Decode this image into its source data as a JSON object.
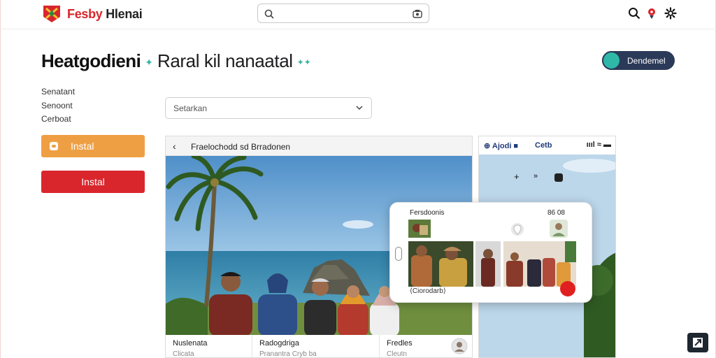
{
  "brand": {
    "name_part1": "Fesby",
    "name_part2": " Hlenai"
  },
  "search": {
    "value": "",
    "placeholder": ""
  },
  "page": {
    "title_bold": "Heatgodieni",
    "title_rest": "Raral kil nanaatal",
    "toggle_label": "Dendemel"
  },
  "sidebar": {
    "links": [
      "Senatant",
      "Senoont",
      "Cerboat"
    ],
    "install_primary": "Instal",
    "install_secondary": "Instal"
  },
  "select": {
    "value": "Setarkan"
  },
  "card": {
    "header_title": "Fraelochodd sd Brradonen",
    "footer": [
      {
        "title": "Nuslenata",
        "sub": "Clicata"
      },
      {
        "title": "Radogdriga",
        "sub": "Pranantra  Cryb ba"
      },
      {
        "title": "Fredles",
        "sub": "Cleutn"
      }
    ]
  },
  "phone": {
    "status_left": "Ajodi",
    "status_mid": "Cetb",
    "status_right": "ıııl ≈ ▬",
    "dialog_title": "Fersdoonis",
    "dialog_right": "86 08",
    "dialog_caption": "Ciorodarb"
  },
  "colors": {
    "accent_red": "#d9262c",
    "accent_orange": "#ef9f43",
    "accent_teal": "#2fb8a8",
    "navy": "#2b3a58"
  }
}
